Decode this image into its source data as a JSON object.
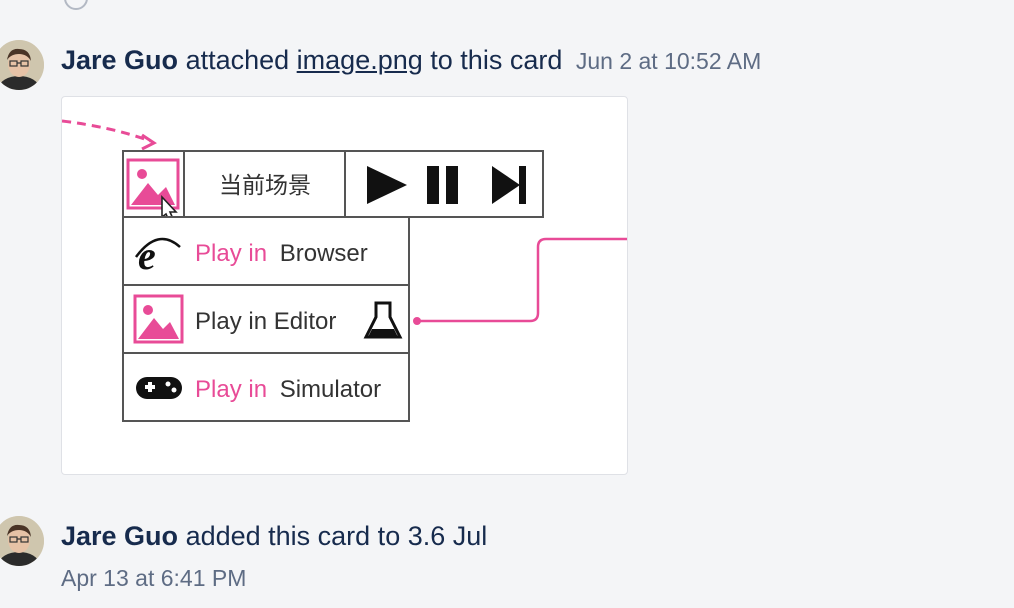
{
  "activities": [
    {
      "author": "Jare Guo",
      "verb": "attached",
      "file_name": "image.png",
      "suffix": "to this card",
      "timestamp": "Jun 2 at 10:52 AM"
    },
    {
      "author": "Jare Guo",
      "verb": "added this card to 3.6 Jul",
      "timestamp": "Apr 13 at 6:41 PM"
    }
  ],
  "attachment_image": {
    "scene_label": "当前场景",
    "menu_items": [
      {
        "prefix": "Play in",
        "rest": "Browser",
        "icon": "ie-icon"
      },
      {
        "prefix": "Play in Editor",
        "rest": "",
        "icon": "image-icon"
      },
      {
        "prefix": "Play in",
        "rest": "Simulator",
        "icon": "gamepad-icon"
      }
    ],
    "accent_color": "#e84b97"
  }
}
